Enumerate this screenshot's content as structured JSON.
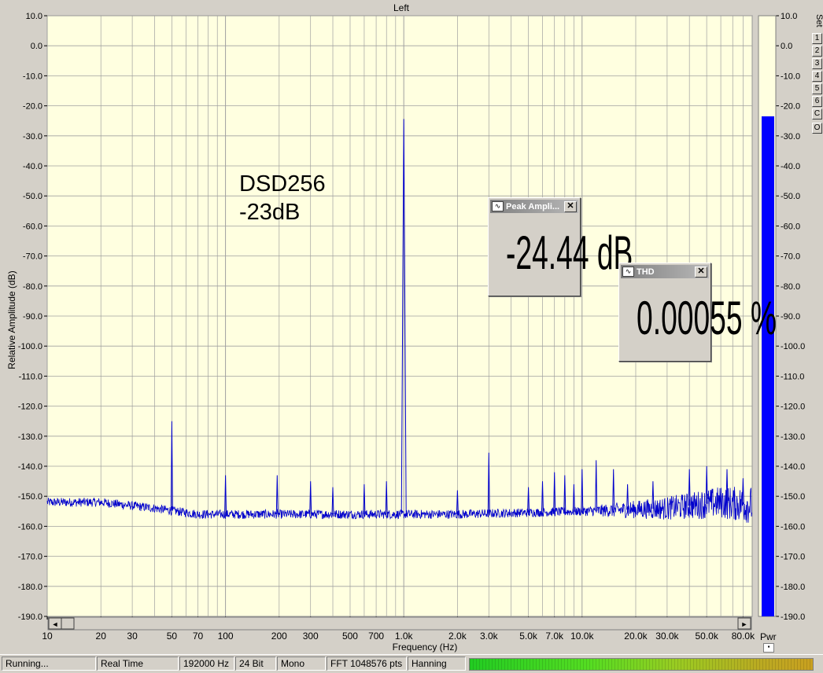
{
  "window": {
    "channel_title": "Left",
    "annotation_line1": "DSD256",
    "annotation_line2": "-23dB",
    "set_label": "Set",
    "set_buttons": [
      "1",
      "2",
      "3",
      "4",
      "5",
      "6",
      "C",
      "O"
    ],
    "pwr_label": "Pwr",
    "pwr_level_db": -23.5
  },
  "meters": {
    "peak": {
      "title": "Peak Ampli...",
      "value": "-24.44 dB"
    },
    "thd": {
      "title": "THD",
      "value": "0.00055 %"
    }
  },
  "status": {
    "state": "Running...",
    "mode": "Real Time",
    "sample_rate": "192000 Hz",
    "bit_depth": "24 Bit",
    "channels": "Mono",
    "fft": "FFT 1048576 pts",
    "window": "Hanning"
  },
  "colors": {
    "plot_bg": "#ffffe0",
    "trace": "#0000cc",
    "grid": "#a0a0a0",
    "bar": "#0000ff"
  },
  "chart_data": {
    "type": "line",
    "title": "Left",
    "xlabel": "Frequency (Hz)",
    "ylabel": "Relative Amplitude (dB)",
    "xscale": "log",
    "xlim": [
      10,
      90000
    ],
    "ylim": [
      -190,
      10
    ],
    "grid": true,
    "x_ticks": [
      "10",
      "20",
      "30",
      "50",
      "70",
      "100",
      "200",
      "300",
      "500",
      "700",
      "1.0k",
      "2.0k",
      "3.0k",
      "5.0k",
      "7.0k",
      "10.0k",
      "20.0k",
      "30.0k",
      "50.0k",
      "80.0k"
    ],
    "y_ticks": [
      "10.0",
      "0.0",
      "-10.0",
      "-20.0",
      "-30.0",
      "-40.0",
      "-50.0",
      "-60.0",
      "-70.0",
      "-80.0",
      "-90.0",
      "-100.0",
      "-110.0",
      "-120.0",
      "-130.0",
      "-140.0",
      "-150.0",
      "-160.0",
      "-170.0",
      "-180.0",
      "-190.0"
    ],
    "series": [
      {
        "noise_floor": [
          {
            "x": 10,
            "y": -152
          },
          {
            "x": 20,
            "y": -152
          },
          {
            "x": 40,
            "y": -154
          },
          {
            "x": 70,
            "y": -156
          },
          {
            "x": 200,
            "y": -156
          },
          {
            "x": 500,
            "y": -156
          },
          {
            "x": 2000,
            "y": -156
          },
          {
            "x": 10000,
            "y": -155
          },
          {
            "x": 30000,
            "y": -154
          },
          {
            "x": 60000,
            "y": -152
          },
          {
            "x": 90000,
            "y": -153
          }
        ],
        "peaks": [
          {
            "x": 50,
            "y": -125
          },
          {
            "x": 100,
            "y": -143
          },
          {
            "x": 195,
            "y": -143
          },
          {
            "x": 300,
            "y": -145
          },
          {
            "x": 400,
            "y": -147
          },
          {
            "x": 600,
            "y": -146
          },
          {
            "x": 800,
            "y": -145
          },
          {
            "x": 1000,
            "y": -24.4
          },
          {
            "x": 2000,
            "y": -148
          },
          {
            "x": 3000,
            "y": -135.5
          },
          {
            "x": 5000,
            "y": -147
          },
          {
            "x": 6000,
            "y": -145
          },
          {
            "x": 7000,
            "y": -142
          },
          {
            "x": 8000,
            "y": -143
          },
          {
            "x": 9000,
            "y": -146
          },
          {
            "x": 10000,
            "y": -141
          },
          {
            "x": 12000,
            "y": -138
          },
          {
            "x": 15000,
            "y": -141
          },
          {
            "x": 18000,
            "y": -146
          },
          {
            "x": 25000,
            "y": -145
          },
          {
            "x": 40000,
            "y": -141
          },
          {
            "x": 50000,
            "y": -140
          },
          {
            "x": 65000,
            "y": -141
          },
          {
            "x": 80000,
            "y": -144
          }
        ]
      }
    ]
  }
}
